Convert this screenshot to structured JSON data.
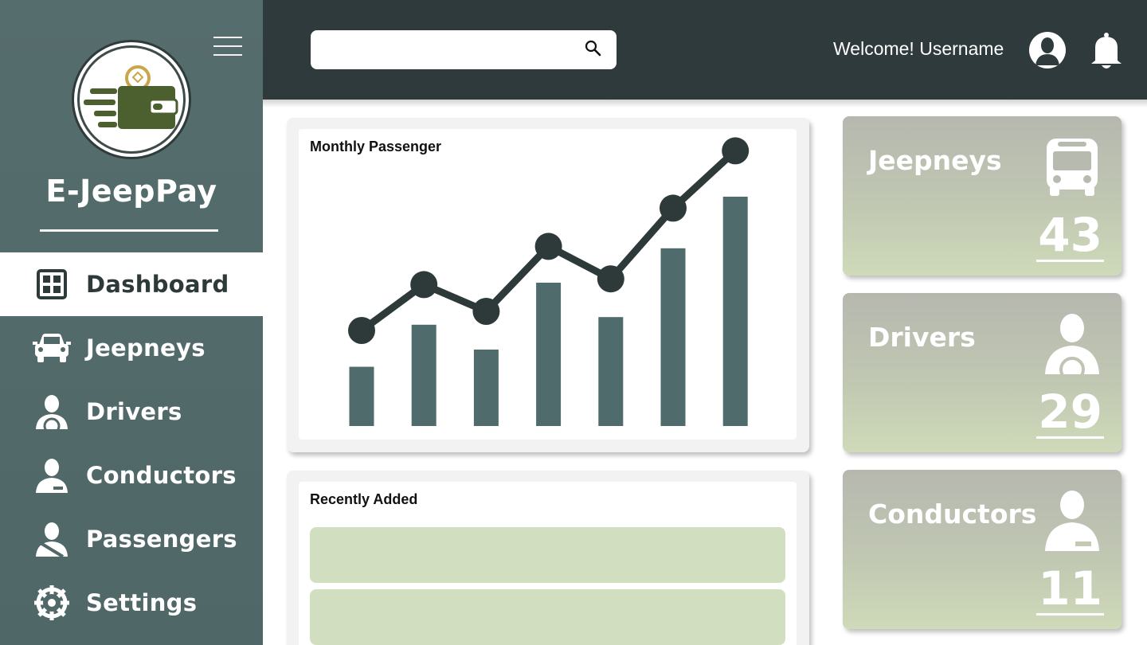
{
  "app": {
    "name": "E-JeepPay"
  },
  "sidebar": {
    "items": [
      {
        "label": "Dashboard",
        "icon": "dashboard-icon",
        "active": true
      },
      {
        "label": "Jeepneys",
        "icon": "car-icon"
      },
      {
        "label": "Drivers",
        "icon": "driver-icon"
      },
      {
        "label": "Conductors",
        "icon": "conductor-icon"
      },
      {
        "label": "Passengers",
        "icon": "passenger-icon"
      },
      {
        "label": "Settings",
        "icon": "gear-icon"
      }
    ]
  },
  "header": {
    "search": {
      "value": "",
      "placeholder": ""
    },
    "welcome": "Welcome! Username"
  },
  "colors": {
    "sidebar": "#566d6d",
    "topbar": "#2e3a3c",
    "bar": "#4f6b6b",
    "line": "#2e3a3a",
    "row": "#d2dec0",
    "logo_green": "#4c5f2e"
  },
  "chart_data": {
    "type": "bar",
    "title": "Monthly Passenger",
    "categories": [
      "",
      "",
      "",
      "",
      "",
      "",
      ""
    ],
    "series": [
      {
        "type": "bar",
        "values": [
          31,
          53,
          40,
          75,
          57,
          93,
          120
        ]
      },
      {
        "type": "line",
        "values": [
          50,
          74,
          60,
          94,
          77,
          114,
          144
        ]
      }
    ],
    "ylim": [
      0,
      150
    ],
    "grid": false,
    "legend": "none"
  },
  "recent": {
    "title": "Recently Added",
    "rows": 2
  },
  "stats": [
    {
      "title": "Jeepneys",
      "value": "43",
      "icon": "bus-icon"
    },
    {
      "title": "Drivers",
      "value": "29",
      "icon": "driver-icon"
    },
    {
      "title": "Conductors",
      "value": "11",
      "icon": "conductor-icon"
    }
  ]
}
